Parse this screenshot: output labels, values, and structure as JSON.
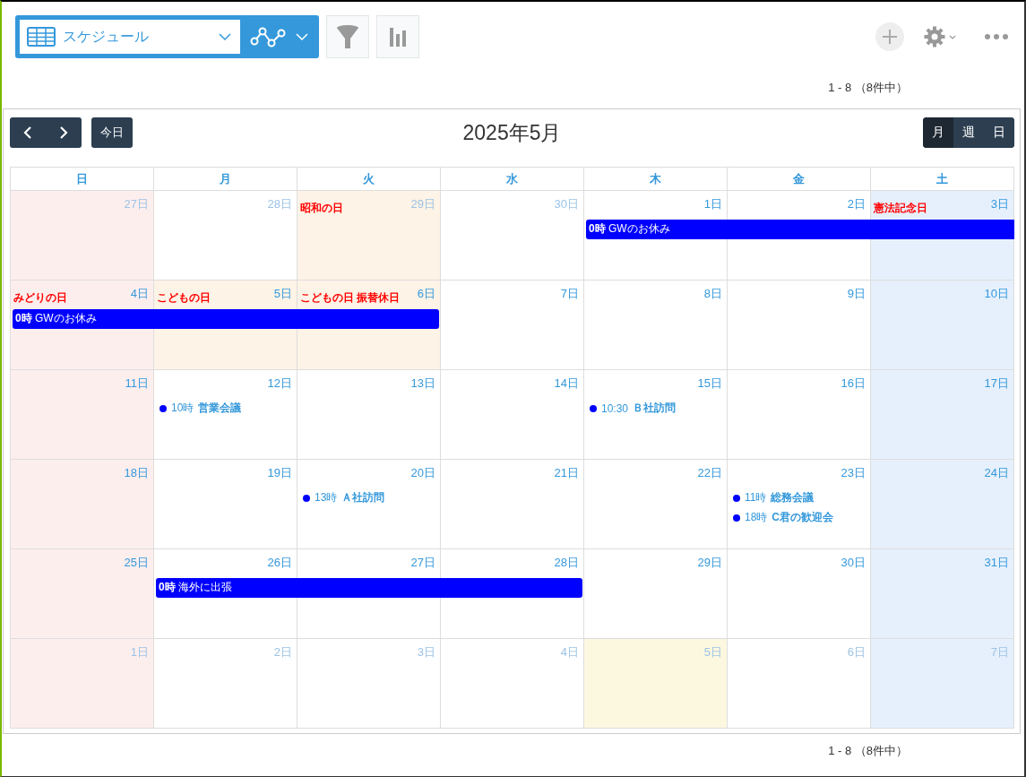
{
  "toolbar": {
    "view_selector": {
      "label": "スケジュール"
    }
  },
  "count_top": "1 - 8 （8件中）",
  "calendar": {
    "title": "2025年5月",
    "today_button": "今日",
    "view_switch": [
      {
        "label": "月",
        "selected": true
      },
      {
        "label": "週",
        "selected": false
      },
      {
        "label": "日",
        "selected": false
      }
    ],
    "weekdays": [
      "日",
      "月",
      "火",
      "水",
      "木",
      "金",
      "土"
    ],
    "weeks": [
      {
        "days": [
          {
            "label": "27日",
            "muted": true,
            "kind": "sunday"
          },
          {
            "label": "28日",
            "muted": true,
            "kind": "weekday"
          },
          {
            "label": "29日",
            "muted": true,
            "kind": "holiday",
            "holiday": "昭和の日"
          },
          {
            "label": "30日",
            "muted": true,
            "kind": "weekday"
          },
          {
            "label": "1日",
            "muted": false,
            "kind": "weekday",
            "span_bar": {
              "time": "0時",
              "title": "GWのお休み",
              "open_end": true
            }
          },
          {
            "label": "2日",
            "muted": false,
            "kind": "weekday",
            "bar_continues": true
          },
          {
            "label": "3日",
            "muted": false,
            "kind": "saturday",
            "holiday": "憲法記念日",
            "bar_continues": true
          }
        ]
      },
      {
        "days": [
          {
            "label": "4日",
            "muted": false,
            "kind": "sunday",
            "holiday": "みどりの日",
            "span_bar": {
              "time": "0時",
              "title": "GWのお休み",
              "open_end": false
            }
          },
          {
            "label": "5日",
            "muted": false,
            "kind": "holiday",
            "holiday": "こどもの日",
            "bar_continues": true
          },
          {
            "label": "6日",
            "muted": false,
            "kind": "holiday",
            "holiday": "こどもの日 振替休日",
            "bar_continues": true
          },
          {
            "label": "7日",
            "muted": false,
            "kind": "weekday"
          },
          {
            "label": "8日",
            "muted": false,
            "kind": "weekday"
          },
          {
            "label": "9日",
            "muted": false,
            "kind": "weekday"
          },
          {
            "label": "10日",
            "muted": false,
            "kind": "saturday"
          }
        ]
      },
      {
        "days": [
          {
            "label": "11日",
            "muted": false,
            "kind": "sunday"
          },
          {
            "label": "12日",
            "muted": false,
            "kind": "weekday",
            "events": [
              {
                "time": "10時",
                "title": "営業会議"
              }
            ]
          },
          {
            "label": "13日",
            "muted": false,
            "kind": "weekday"
          },
          {
            "label": "14日",
            "muted": false,
            "kind": "weekday"
          },
          {
            "label": "15日",
            "muted": false,
            "kind": "weekday",
            "events": [
              {
                "time": "10:30",
                "title": "Ｂ社訪問"
              }
            ]
          },
          {
            "label": "16日",
            "muted": false,
            "kind": "weekday"
          },
          {
            "label": "17日",
            "muted": false,
            "kind": "saturday"
          }
        ]
      },
      {
        "days": [
          {
            "label": "18日",
            "muted": false,
            "kind": "sunday"
          },
          {
            "label": "19日",
            "muted": false,
            "kind": "weekday"
          },
          {
            "label": "20日",
            "muted": false,
            "kind": "weekday",
            "events": [
              {
                "time": "13時",
                "title": "Ａ社訪問"
              }
            ]
          },
          {
            "label": "21日",
            "muted": false,
            "kind": "weekday"
          },
          {
            "label": "22日",
            "muted": false,
            "kind": "weekday"
          },
          {
            "label": "23日",
            "muted": false,
            "kind": "weekday",
            "events": [
              {
                "time": "11時",
                "title": "総務会議"
              },
              {
                "time": "18時",
                "title": "C君の歓迎会"
              }
            ]
          },
          {
            "label": "24日",
            "muted": false,
            "kind": "saturday"
          }
        ]
      },
      {
        "days": [
          {
            "label": "25日",
            "muted": false,
            "kind": "sunday"
          },
          {
            "label": "26日",
            "muted": false,
            "kind": "weekday",
            "span_bar": {
              "time": "0時",
              "title": "海外に出張",
              "open_end": false
            }
          },
          {
            "label": "27日",
            "muted": false,
            "kind": "weekday",
            "bar_continues": true
          },
          {
            "label": "28日",
            "muted": false,
            "kind": "weekday",
            "bar_continues": true
          },
          {
            "label": "29日",
            "muted": false,
            "kind": "weekday"
          },
          {
            "label": "30日",
            "muted": false,
            "kind": "weekday"
          },
          {
            "label": "31日",
            "muted": false,
            "kind": "saturday"
          }
        ]
      },
      {
        "days": [
          {
            "label": "1日",
            "muted": true,
            "kind": "sunday"
          },
          {
            "label": "2日",
            "muted": true,
            "kind": "weekday"
          },
          {
            "label": "3日",
            "muted": true,
            "kind": "weekday"
          },
          {
            "label": "4日",
            "muted": true,
            "kind": "weekday"
          },
          {
            "label": "5日",
            "muted": true,
            "kind": "today"
          },
          {
            "label": "6日",
            "muted": true,
            "kind": "weekday"
          },
          {
            "label": "7日",
            "muted": true,
            "kind": "saturday"
          }
        ]
      }
    ]
  },
  "count_bottom": "1 - 8 （8件中）"
}
